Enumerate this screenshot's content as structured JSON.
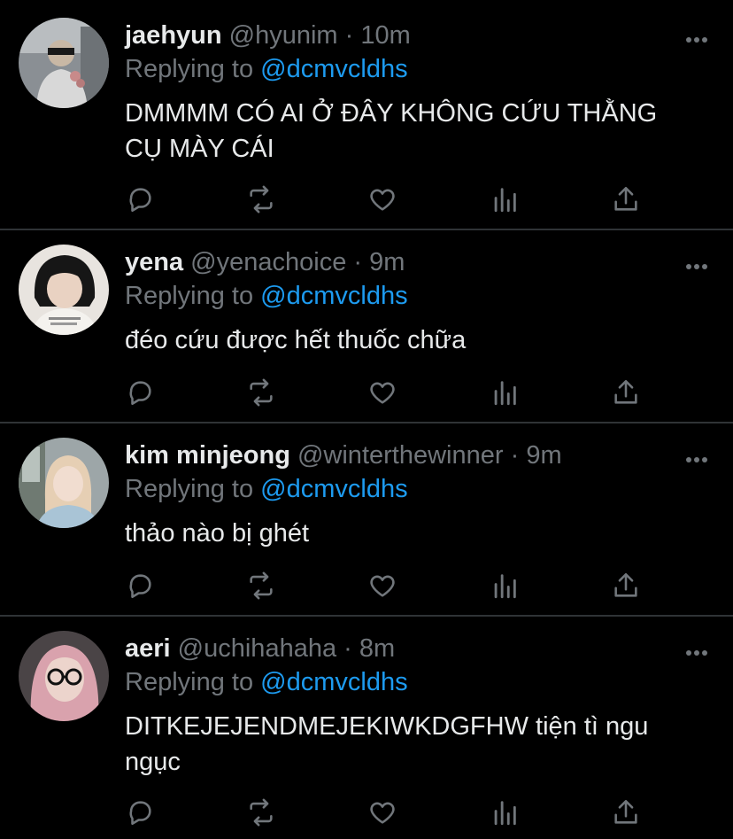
{
  "tweets": [
    {
      "name": "jaehyun",
      "handle": "@hyunim",
      "dot": "·",
      "time": "10m",
      "replying_prefix": "Replying to ",
      "replying_to": "@dcmvcldhs",
      "body_line1": "DMMMM CÓ AI Ở ĐÂY KHÔNG CỨU THẰNG",
      "body_line2": "CỤ MÀY CÁI"
    },
    {
      "name": "yena",
      "handle": "@yenachoice",
      "dot": "·",
      "time": "9m",
      "replying_prefix": "Replying to ",
      "replying_to": "@dcmvcldhs",
      "body_line1": "đéo cứu được hết thuốc chữa",
      "body_line2": ""
    },
    {
      "name": "kim minjeong",
      "handle": "@winterthewinner",
      "dot": "·",
      "time": "9m",
      "replying_prefix": "Replying to ",
      "replying_to": "@dcmvcldhs",
      "body_line1": "thảo nào bị ghét",
      "body_line2": ""
    },
    {
      "name": "aeri",
      "handle": "@uchihahaha",
      "dot": "·",
      "time": "8m",
      "replying_prefix": "Replying to ",
      "replying_to": "@dcmvcldhs",
      "body_line1": "DITKEJEJENDMEJEKIWKDGFHW tiện tì ngu",
      "body_line2": "ngục"
    }
  ],
  "icons": {
    "reply": "reply-icon",
    "retweet": "retweet-icon",
    "like": "heart-icon",
    "analytics": "analytics-icon",
    "share": "share-icon",
    "more": "more-icon"
  },
  "colors": {
    "background": "#000000",
    "text": "#e7e9ea",
    "secondary": "#71767b",
    "mention": "#1d9bf0",
    "divider": "#2f3336"
  }
}
